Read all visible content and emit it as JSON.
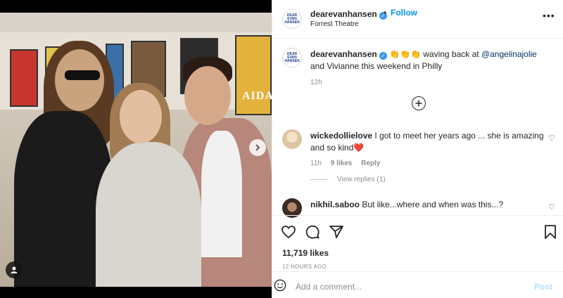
{
  "post": {
    "account": "dearevanhansen",
    "follow_label": "Follow",
    "dot": "•",
    "location": "Forrest Theatre",
    "avatar_logo": "DEAR EVAN HANSEN",
    "more_icon": "more-horizontal-icon",
    "caption_emojis": "👏👏👏",
    "caption_pre": " waving back at ",
    "caption_mention": "@angelinajolie",
    "caption_post": " and Vivianne this weekend in Philly",
    "caption_time": "12h",
    "photo_sign": "AIDA"
  },
  "load_more_icon": "plus-circle-icon",
  "comments": [
    {
      "user": "wickedollielove",
      "text": " I got to meet her years ago ... she is amazing and so kind",
      "emoji": "❤️",
      "time": "11h",
      "likes": "9 likes",
      "reply": "Reply",
      "view_replies": "View replies (1)"
    },
    {
      "user": "nikhil.saboo",
      "text": " But like...where and when was this...?"
    }
  ],
  "actions": {
    "likes": "11,719 likes",
    "timestamp": "12 HOURS AGO",
    "add_comment_placeholder": "Add a comment...",
    "post_label": "Post"
  },
  "colors": {
    "link_blue": "#0095f6",
    "mention_blue": "#00376b",
    "post_disabled": "#b2dffc",
    "verified": "#3897f0",
    "heart_red": "#ed4956"
  }
}
